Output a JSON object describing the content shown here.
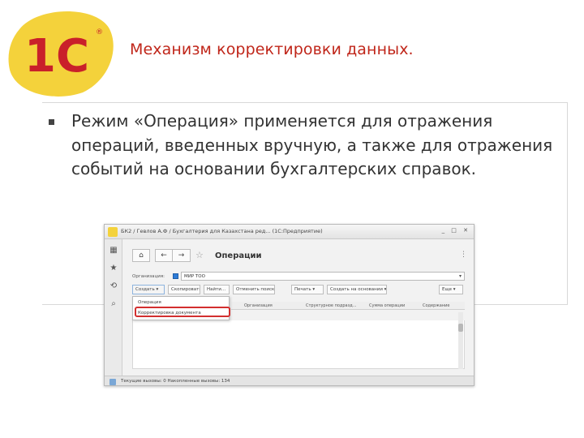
{
  "slide": {
    "title": "Механизм корректировки данных.",
    "logo_text": "1С",
    "body": "Режим «Операция» применяется для отражения операций, введенных вручную, а также для отражения событий на основании бухгалтерских справок."
  },
  "colors": {
    "title_red": "#c0261a",
    "logo_yellow": "#f4d23b",
    "logo_red": "#c9202a",
    "highlight_red": "#d32f2f"
  },
  "app_window": {
    "title": "БК2 / Гевлов А.Ф / Бухгалтерия для Казахстана ред... (1С:Предприятие)",
    "form_title": "Операции",
    "org_label": "Организация:",
    "org_value": "МИР ТОО",
    "toolbar": {
      "create": "Создать ▾",
      "btn2": "Скопировать",
      "find": "Найти...",
      "cancel_search": "Отменить поиск",
      "print": "Печать ▾",
      "create_based_on": "Создать на основании ▾",
      "more": "Еще ▾"
    },
    "dropdown_items": [
      "Операция",
      "Корректировка документа"
    ],
    "columns": [
      "Организация",
      "Структурное подразд...",
      "Сумма операции",
      "Содержание"
    ],
    "status": "Текущие вызовы: 0   Накопленные вызовы: 134",
    "sidebar_icons": [
      "apps-icon",
      "star-icon",
      "history-icon",
      "search-icon"
    ]
  }
}
